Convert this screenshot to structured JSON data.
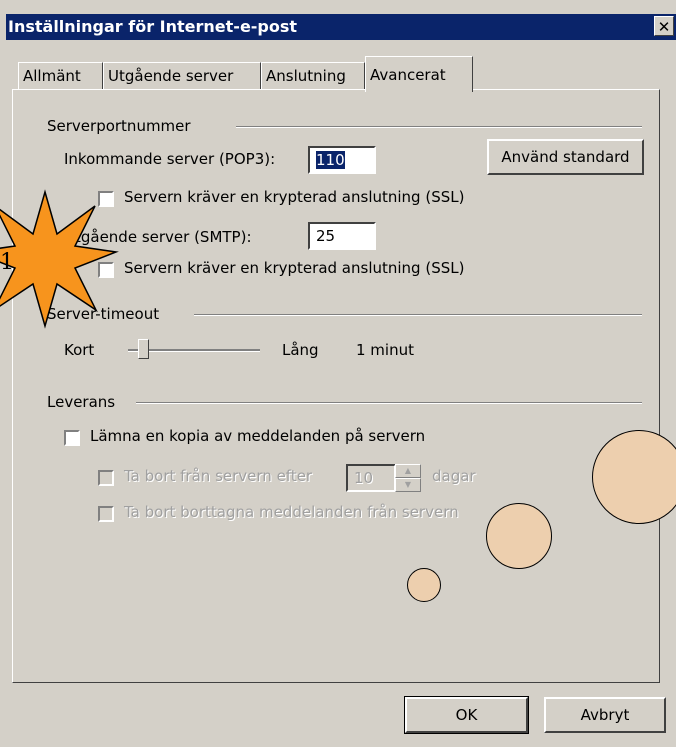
{
  "window": {
    "title": "Inställningar för Internet-e-post",
    "close_label": "✕"
  },
  "tabs": [
    {
      "label": "Allmänt",
      "active": false
    },
    {
      "label": "Utgående server",
      "active": false
    },
    {
      "label": "Anslutning",
      "active": false
    },
    {
      "label": "Avancerat",
      "active": true
    }
  ],
  "server_ports": {
    "heading": "Serverportnummer",
    "incoming_label": "Inkommande server (POP3):",
    "incoming_value": "110",
    "default_button": "Använd standard",
    "incoming_ssl": {
      "label": "Servern kräver en krypterad anslutning (SSL)",
      "checked": false
    },
    "outgoing_label": "Utgående server (SMTP):",
    "outgoing_value": "25",
    "outgoing_ssl": {
      "label": "Servern kräver en krypterad anslutning (SSL)",
      "checked": false
    }
  },
  "timeout": {
    "heading": "Server-timeout",
    "min_label": "Kort",
    "max_label": "Lång",
    "value_text": "1 minut"
  },
  "delivery": {
    "heading": "Leverans",
    "leave_copy": {
      "label": "Lämna en kopia av meddelanden på servern",
      "checked": false
    },
    "remove_after": {
      "label": "Ta bort från servern efter",
      "value": "10",
      "unit": "dagar",
      "enabled": false
    },
    "remove_deleted": {
      "label": "Ta bort borttagna meddelanden från servern",
      "enabled": false
    }
  },
  "footer": {
    "ok": "OK",
    "cancel": "Avbryt"
  },
  "annotation": {
    "star_number": "1",
    "star_color": "#f7941d",
    "circle_color": "#edcfae"
  }
}
